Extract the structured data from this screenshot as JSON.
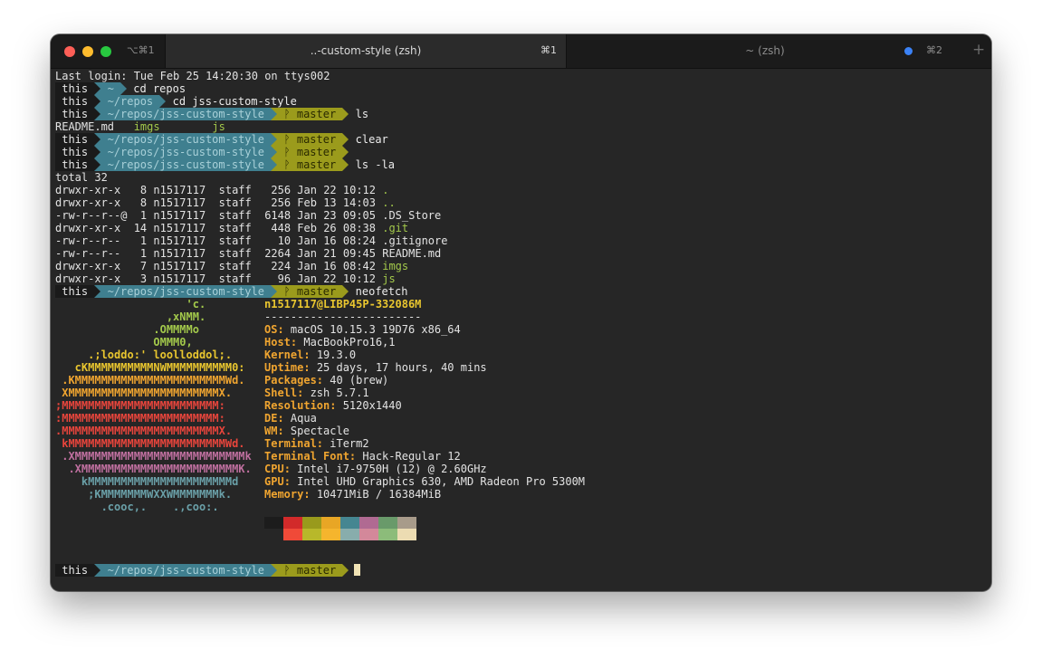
{
  "window": {
    "left_shortcut": "⌥⌘1",
    "active_tab": {
      "title": "..-custom-style (zsh)",
      "shortcut": "⌘1"
    },
    "inactive_tab": {
      "title": "~ (zsh)",
      "shortcut": "⌘2"
    },
    "new_tab_glyph": "+"
  },
  "prompt": {
    "user": "this",
    "arrow": "➡"
  },
  "terminal": {
    "last_login": "Last login: Tue Feb 25 14:20:30 on ttys002",
    "prompts": [
      {
        "dir": "~",
        "git": "",
        "cmd": "cd repos"
      },
      {
        "dir": "~/repos",
        "git": "",
        "cmd": "cd jss-custom-style"
      },
      {
        "dir": "~/repos/jss-custom-style",
        "git": "ᚹ master",
        "cmd": "ls"
      },
      {
        "dir": "~/repos/jss-custom-style",
        "git": "ᚹ master",
        "cmd": "clear"
      },
      {
        "dir": "~/repos/jss-custom-style",
        "git": "ᚹ master",
        "cmd": ""
      },
      {
        "dir": "~/repos/jss-custom-style",
        "git": "ᚹ master",
        "cmd": "ls -la"
      },
      {
        "dir": "~/repos/jss-custom-style",
        "git": "ᚹ master",
        "cmd": "neofetch"
      },
      {
        "dir": "~/repos/jss-custom-style",
        "git": "ᚹ master",
        "cmd": ""
      }
    ],
    "ls_output": {
      "file": "README.md",
      "dir1": "imgs",
      "dir2": "js"
    },
    "total": "total 32",
    "ls_la": [
      {
        "perm": "drwxr-xr-x   8 n1517117  staff   256 Jan 22 10:12 ",
        "name": ".",
        "dir": true
      },
      {
        "perm": "drwxr-xr-x   8 n1517117  staff   256 Feb 13 14:03 ",
        "name": "..",
        "dir": true
      },
      {
        "perm": "-rw-r--r--@  1 n1517117  staff  6148 Jan 23 09:05 ",
        "name": ".DS_Store",
        "dir": false
      },
      {
        "perm": "drwxr-xr-x  14 n1517117  staff   448 Feb 26 08:38 ",
        "name": ".git",
        "dir": true
      },
      {
        "perm": "-rw-r--r--   1 n1517117  staff    10 Jan 16 08:24 ",
        "name": ".gitignore",
        "dir": false
      },
      {
        "perm": "-rw-r--r--   1 n1517117  staff  2264 Jan 21 09:45 ",
        "name": "README.md",
        "dir": false
      },
      {
        "perm": "drwxr-xr-x   7 n1517117  staff   224 Jan 16 08:42 ",
        "name": "imgs",
        "dir": true
      },
      {
        "perm": "drwxr-xr-x   3 n1517117  staff    96 Jan 22 10:12 ",
        "name": "js",
        "dir": true
      }
    ],
    "neofetch": {
      "logo": [
        {
          "text": "                    'c.",
          "color": "#a3c94b"
        },
        {
          "text": "                 ,xNMM.",
          "color": "#a3c94b"
        },
        {
          "text": "               .OMMMMo",
          "color": "#a3c94b"
        },
        {
          "text": "               OMMM0,",
          "color": "#a3c94b"
        },
        {
          "text": "     .;loddo:' loolloddol;.",
          "color": "#e9c62f"
        },
        {
          "text": "   cKMMMMMMMMMMNWMMMMMMMMMM0:",
          "color": "#e9c62f"
        },
        {
          "text": " .KMMMMMMMMMMMMMMMMMMMMMMMWd.",
          "color": "#f0a530"
        },
        {
          "text": " XMMMMMMMMMMMMMMMMMMMMMMMX.",
          "color": "#f0a530"
        },
        {
          "text": ";MMMMMMMMMMMMMMMMMMMMMMMM:",
          "color": "#e8453c"
        },
        {
          "text": ":MMMMMMMMMMMMMMMMMMMMMMMM:",
          "color": "#e8453c"
        },
        {
          "text": ".MMMMMMMMMMMMMMMMMMMMMMMMX.",
          "color": "#e8453c"
        },
        {
          "text": " kMMMMMMMMMMMMMMMMMMMMMMMMWd.",
          "color": "#e8453c"
        },
        {
          "text": " .XMMMMMMMMMMMMMMMMMMMMMMMMMMk",
          "color": "#c070a0"
        },
        {
          "text": "  .XMMMMMMMMMMMMMMMMMMMMMMMMK.",
          "color": "#c070a0"
        },
        {
          "text": "    kMMMMMMMMMMMMMMMMMMMMMMd",
          "color": "#6aa0a8"
        },
        {
          "text": "     ;KMMMMMMMWXXWMMMMMMMk.",
          "color": "#6aa0a8"
        },
        {
          "text": "       .cooc,.    .,coo:.",
          "color": "#6aa0a8"
        }
      ],
      "user_host": "n1517117@LIBP45P-332086M",
      "separator": "------------------------",
      "info": [
        {
          "key": "OS",
          "value": "macOS 10.15.3 19D76 x86_64"
        },
        {
          "key": "Host",
          "value": "MacBookPro16,1"
        },
        {
          "key": "Kernel",
          "value": "19.3.0"
        },
        {
          "key": "Uptime",
          "value": "25 days, 17 hours, 40 mins"
        },
        {
          "key": "Packages",
          "value": "40 (brew)"
        },
        {
          "key": "Shell",
          "value": "zsh 5.7.1"
        },
        {
          "key": "Resolution",
          "value": "5120x1440"
        },
        {
          "key": "DE",
          "value": "Aqua"
        },
        {
          "key": "WM",
          "value": "Spectacle"
        },
        {
          "key": "Terminal",
          "value": "iTerm2"
        },
        {
          "key": "Terminal Font",
          "value": "Hack-Regular 12"
        },
        {
          "key": "CPU",
          "value": "Intel i7-9750H (12) @ 2.60GHz"
        },
        {
          "key": "GPU",
          "value": "Intel UHD Graphics 630, AMD Radeon Pro 5300M"
        },
        {
          "key": "Memory",
          "value": "10471MiB / 16384MiB"
        }
      ],
      "palette_top": [
        "#1c1c1c",
        "#d22a2a",
        "#999a1c",
        "#e8a625",
        "#458691",
        "#b06a92",
        "#699a6a",
        "#a89b8a"
      ],
      "palette_bottom": [
        "#262626",
        "#f04a38",
        "#b8b82a",
        "#f5b52d",
        "#88adac",
        "#d3889a",
        "#8cbc7a",
        "#ecdcb2"
      ]
    }
  }
}
